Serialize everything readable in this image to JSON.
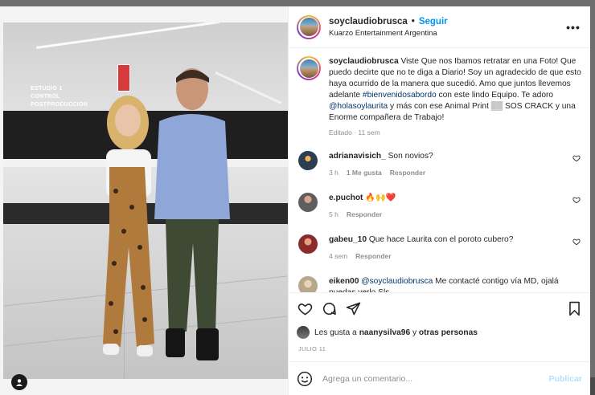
{
  "post": {
    "username": "soyclaudiobrusca",
    "follow_label": "Seguir",
    "location": "Kuarzo Entertainment Argentina",
    "caption_pre": "Viste Que nos Ibamos retratar en una Foto! Que puedo decirte que no te diga a Diario! Soy un agradecido de que esto haya ocurrido de la manera que sucedió. Amo que juntos llevemos adelante ",
    "caption_hashtag": "#bienvenidosabordo",
    "caption_mid": " con este lindo Equipo. Te adoro ",
    "caption_mention": "@holasoylaurita",
    "caption_post": " y más con ese Animal Print ▒▒ SOS CRACK y una Enorme compañera de Trabajo!",
    "edited": "Editado",
    "time": "11 sem"
  },
  "photo": {
    "signs": [
      "ESTUDIO 1",
      "CONTROL",
      "POSTPRODUCCION"
    ]
  },
  "comments": [
    {
      "user": "adrianavisich_",
      "text": "Son novios?",
      "time": "3 h",
      "likes": "1 Me gusta",
      "reply": "Responder",
      "color": "#2c3e50"
    },
    {
      "user": "e.puchot",
      "text": "🔥🙌❤️",
      "time": "5 h",
      "likes": "",
      "reply": "Responder",
      "color": "#6b6b6b"
    },
    {
      "user": "gabeu_10",
      "text": "Que hace Laurita con el poroto cubero?",
      "time": "4 sem",
      "likes": "",
      "reply": "Responder",
      "color": "#8b2b2b"
    },
    {
      "user": "eiken00",
      "text_mention": "@soyclaudiobrusca",
      "text": " Me contacté contigo vía MD, ojalá puedas verlo Sls",
      "color": "#b8a88a"
    }
  ],
  "likes": {
    "prefix": "Les gusta a ",
    "user": "naanysilva96",
    "mid": " y ",
    "others": "otras personas"
  },
  "date": "JULIO 11",
  "add_comment": {
    "placeholder": "Agrega un comentario...",
    "publish": "Publicar"
  },
  "icons": [
    "more-icon",
    "heart-icon",
    "comment-icon",
    "share-icon",
    "save-icon",
    "emoji-icon",
    "user-tag-icon"
  ]
}
